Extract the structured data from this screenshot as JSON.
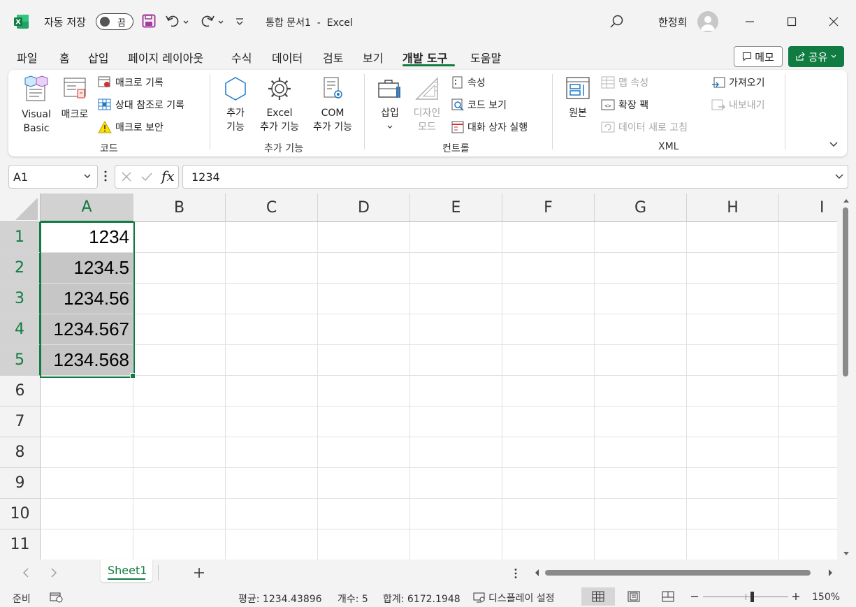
{
  "titlebar": {
    "autosave_label": "자동 저장",
    "autosave_state": "끔",
    "doc_title": "통합 문서1  -  Excel",
    "user_name": "한정희"
  },
  "menu": {
    "tabs": [
      "파일",
      "홈",
      "삽입",
      "페이지 레이아웃",
      "수식",
      "데이터",
      "검토",
      "보기",
      "개발 도구",
      "도움말"
    ],
    "active_tab": "개발 도구",
    "memo_label": "메모",
    "share_label": "공유"
  },
  "ribbon": {
    "code_group": {
      "label": "코드",
      "visual_basic": "Visual\nBasic",
      "macro": "매크로",
      "record_macro": "매크로 기록",
      "relative_ref": "상대 참조로 기록",
      "macro_security": "매크로 보안"
    },
    "addins_group": {
      "label": "추가 기능",
      "addins": "추가\n기능",
      "excel_addins": "Excel\n추가 기능",
      "com_addins": "COM\n추가 기능"
    },
    "controls_group": {
      "label": "컨트롤",
      "insert": "삽입",
      "design_mode": "디자인\n모드",
      "properties": "속성",
      "view_code": "코드 보기",
      "run_dialog": "대화 상자 실행"
    },
    "xml_group": {
      "label": "XML",
      "source": "원본",
      "map_properties": "맵 속성",
      "expansion_packs": "확장 팩",
      "refresh_data": "데이터 새로 고침",
      "import": "가져오기",
      "export": "내보내기"
    }
  },
  "formula_bar": {
    "name_box": "A1",
    "fx": "fx",
    "value": "1234"
  },
  "sheet": {
    "columns": [
      "A",
      "B",
      "C",
      "D",
      "E",
      "F",
      "G",
      "H",
      "I"
    ],
    "rows": [
      "1",
      "2",
      "3",
      "4",
      "5",
      "6",
      "7",
      "8",
      "9",
      "10",
      "11"
    ],
    "col_a_values": [
      "1234",
      "1234.5",
      "1234.56",
      "1234.567",
      "1234.568"
    ],
    "tab_name": "Sheet1"
  },
  "statusbar": {
    "ready": "준비",
    "average": "평균: 1234.43896",
    "count": "개수: 5",
    "sum": "합계: 6172.1948",
    "display_settings": "디스플레이 설정",
    "zoom": "150%"
  },
  "colors": {
    "accent": "#107c41",
    "selection_fill": "#c6c6c6"
  }
}
